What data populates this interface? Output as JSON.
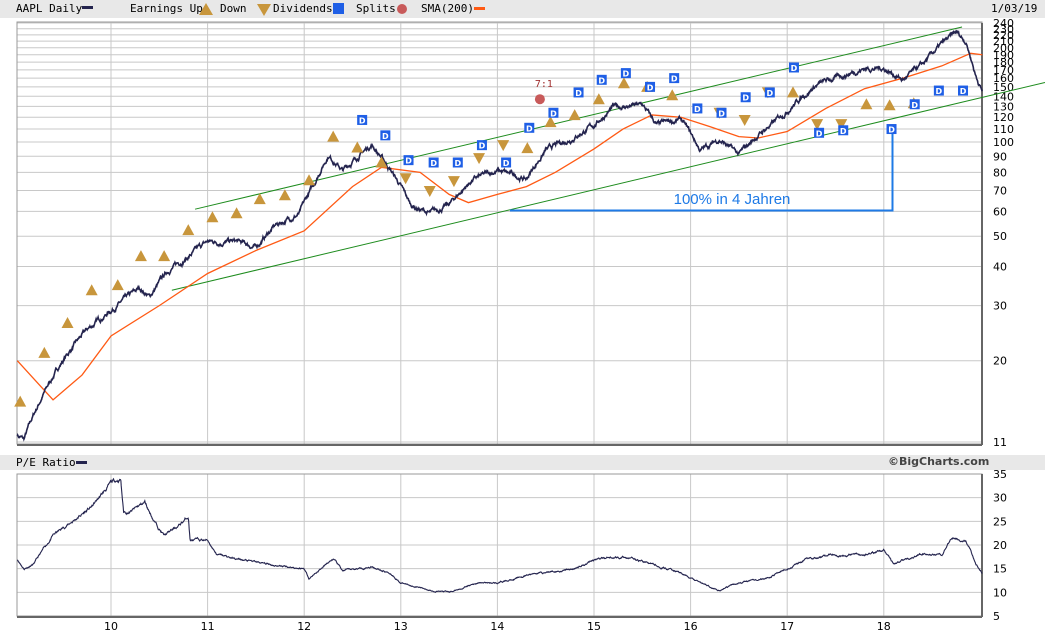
{
  "header": {
    "symbol_label": "AAPL Daily",
    "earnings_up_label": "Earnings Up",
    "down_label": "Down",
    "dividends_label": "Dividends",
    "splits_label": "Splits",
    "sma_label": "SMA(200)",
    "date": "1/03/19"
  },
  "lower_header": {
    "title": "P/E Ratio",
    "copyright": "©BigCharts.com"
  },
  "colors": {
    "price": "#24244e",
    "sma": "#ff5a14",
    "earnings": "#c8963c",
    "dividend": "#1f5fe6",
    "split": "#c85a5a",
    "channel": "#1e8c1e",
    "annotation": "#1e7ae6",
    "grid": "#c8c8c8"
  },
  "chart_data": [
    {
      "type": "line",
      "title": "AAPL Daily",
      "scale": "log",
      "ylim": [
        11,
        240
      ],
      "xlim": [
        2009.03,
        2019.02
      ],
      "y_ticks": [
        "240",
        "230",
        "220",
        "210",
        "200",
        "190",
        "180",
        "170",
        "160",
        "150",
        "140",
        "130",
        "120",
        "110",
        "100",
        "90",
        "80",
        "70",
        "60",
        "50",
        "40",
        "30",
        "20",
        "11"
      ],
      "x_ticks": [
        "10",
        "11",
        "12",
        "13",
        "14",
        "15",
        "16",
        "17",
        "18"
      ],
      "series": [
        {
          "name": "AAPL",
          "points": [
            [
              2009.03,
              11.6
            ],
            [
              2009.1,
              11.2
            ],
            [
              2009.3,
              15.6
            ],
            [
              2009.5,
              20
            ],
            [
              2009.75,
              25
            ],
            [
              2010.0,
              29
            ],
            [
              2010.3,
              34
            ],
            [
              2010.4,
              32
            ],
            [
              2010.6,
              39
            ],
            [
              2010.8,
              43
            ],
            [
              2011.0,
              48
            ],
            [
              2011.3,
              48
            ],
            [
              2011.5,
              46
            ],
            [
              2011.7,
              54
            ],
            [
              2011.95,
              59
            ],
            [
              2012.1,
              73
            ],
            [
              2012.25,
              91
            ],
            [
              2012.4,
              81
            ],
            [
              2012.7,
              98
            ],
            [
              2012.9,
              81
            ],
            [
              2013.1,
              63
            ],
            [
              2013.3,
              59
            ],
            [
              2013.5,
              63
            ],
            [
              2013.75,
              76
            ],
            [
              2014.0,
              81
            ],
            [
              2014.3,
              76
            ],
            [
              2014.5,
              94
            ],
            [
              2014.75,
              102
            ],
            [
              2015.0,
              113
            ],
            [
              2015.2,
              129
            ],
            [
              2015.5,
              131
            ],
            [
              2015.65,
              113
            ],
            [
              2015.9,
              118
            ],
            [
              2016.1,
              94
            ],
            [
              2016.3,
              102
            ],
            [
              2016.5,
              91
            ],
            [
              2016.7,
              105
            ],
            [
              2016.9,
              118
            ],
            [
              2017.1,
              135
            ],
            [
              2017.3,
              152
            ],
            [
              2017.6,
              164
            ],
            [
              2017.8,
              172
            ],
            [
              2018.0,
              172
            ],
            [
              2018.2,
              158
            ],
            [
              2018.4,
              176
            ],
            [
              2018.6,
              205
            ],
            [
              2018.75,
              223
            ],
            [
              2018.85,
              210
            ],
            [
              2018.95,
              164
            ],
            [
              2019.02,
              145
            ]
          ]
        },
        {
          "name": "SMA(200)",
          "points": [
            [
              2009.03,
              20
            ],
            [
              2009.4,
              15
            ],
            [
              2009.7,
              18
            ],
            [
              2010.0,
              24
            ],
            [
              2010.5,
              30
            ],
            [
              2011.0,
              38
            ],
            [
              2011.5,
              45
            ],
            [
              2012.0,
              52
            ],
            [
              2012.5,
              72
            ],
            [
              2012.8,
              83
            ],
            [
              2013.2,
              80
            ],
            [
              2013.5,
              68
            ],
            [
              2013.7,
              64
            ],
            [
              2014.0,
              68
            ],
            [
              2014.3,
              72
            ],
            [
              2014.6,
              80
            ],
            [
              2015.0,
              95
            ],
            [
              2015.3,
              110
            ],
            [
              2015.6,
              122
            ],
            [
              2015.9,
              120
            ],
            [
              2016.2,
              112
            ],
            [
              2016.5,
              104
            ],
            [
              2016.7,
              103
            ],
            [
              2017.0,
              108
            ],
            [
              2017.4,
              128
            ],
            [
              2017.8,
              148
            ],
            [
              2018.2,
              160
            ],
            [
              2018.6,
              175
            ],
            [
              2018.9,
              192
            ],
            [
              2019.02,
              190
            ]
          ]
        }
      ],
      "earnings": [
        [
          2009.06,
          14.8,
          "up"
        ],
        [
          2009.31,
          21.2,
          "up"
        ],
        [
          2009.55,
          26.4,
          "up"
        ],
        [
          2009.8,
          33.6,
          "up"
        ],
        [
          2010.07,
          34.9,
          "up"
        ],
        [
          2010.31,
          43.2,
          "up"
        ],
        [
          2010.55,
          43.2,
          "up"
        ],
        [
          2010.8,
          52.3,
          "up"
        ],
        [
          2011.05,
          57.5,
          "up"
        ],
        [
          2011.3,
          59.2,
          "up"
        ],
        [
          2011.54,
          65.7,
          "up"
        ],
        [
          2011.8,
          67.6,
          "up"
        ],
        [
          2012.05,
          75.5,
          "up"
        ],
        [
          2012.3,
          104,
          "up"
        ],
        [
          2012.55,
          96,
          "up"
        ],
        [
          2012.8,
          86,
          "up"
        ],
        [
          2013.05,
          76.6,
          "down"
        ],
        [
          2013.3,
          69.7,
          "down"
        ],
        [
          2013.55,
          75,
          "down"
        ],
        [
          2013.81,
          88.8,
          "down"
        ],
        [
          2014.06,
          97.7,
          "down"
        ],
        [
          2014.31,
          95.6,
          "up"
        ],
        [
          2014.55,
          115.7,
          "up"
        ],
        [
          2014.8,
          121.8,
          "up"
        ],
        [
          2015.05,
          137,
          "up"
        ],
        [
          2015.31,
          154,
          "up"
        ],
        [
          2015.55,
          150,
          "up"
        ],
        [
          2015.81,
          141,
          "up"
        ],
        [
          2016.3,
          124,
          "down"
        ],
        [
          2016.56,
          117.6,
          "down"
        ],
        [
          2016.8,
          144,
          "down"
        ],
        [
          2017.06,
          144,
          "up"
        ],
        [
          2017.31,
          114,
          "down"
        ],
        [
          2017.56,
          114,
          "down"
        ],
        [
          2017.82,
          132,
          "up"
        ],
        [
          2018.06,
          131,
          "up"
        ],
        [
          2018.31,
          133,
          "up"
        ]
      ],
      "dividends": [
        [
          2012.6,
          117.6
        ],
        [
          2012.84,
          105
        ],
        [
          2013.08,
          87.5
        ],
        [
          2013.34,
          86
        ],
        [
          2013.59,
          86
        ],
        [
          2013.84,
          97.7
        ],
        [
          2014.09,
          86
        ],
        [
          2014.33,
          111
        ],
        [
          2014.58,
          124
        ],
        [
          2014.84,
          144
        ],
        [
          2015.08,
          158
        ],
        [
          2015.33,
          166
        ],
        [
          2015.58,
          150
        ],
        [
          2015.83,
          160
        ],
        [
          2016.07,
          128
        ],
        [
          2016.32,
          124
        ],
        [
          2016.57,
          139
        ],
        [
          2016.82,
          144
        ],
        [
          2017.07,
          173
        ],
        [
          2017.33,
          107
        ],
        [
          2017.58,
          109
        ],
        [
          2018.08,
          110
        ],
        [
          2018.32,
          132
        ],
        [
          2018.57,
          146
        ],
        [
          2018.82,
          146
        ]
      ],
      "splits": [
        {
          "date": 2014.44,
          "price": 137,
          "label": "7:1"
        }
      ],
      "channel_lines": [
        [
          [
            2010.87,
            61
          ],
          [
            2018.81,
            233
          ]
        ],
        [
          [
            2010.63,
            33.6
          ],
          [
            2019.67,
            155
          ]
        ]
      ],
      "annotation": {
        "text": "100% in 4 Jahren",
        "start": [
          2014.13,
          60.4
        ],
        "corner": [
          2018.09,
          60.4
        ],
        "end": [
          2018.09,
          113
        ]
      }
    },
    {
      "type": "line",
      "title": "P/E Ratio",
      "ylim": [
        5,
        35
      ],
      "y_ticks": [
        "35",
        "30",
        "25",
        "20",
        "15",
        "10",
        "5"
      ],
      "x_ticks": [
        "10",
        "11",
        "12",
        "13",
        "14",
        "15",
        "16",
        "17",
        "18"
      ],
      "series": [
        {
          "name": "P/E Ratio",
          "points": [
            [
              2009.03,
              17
            ],
            [
              2009.1,
              15
            ],
            [
              2009.2,
              16
            ],
            [
              2009.4,
              22
            ],
            [
              2009.6,
              25
            ],
            [
              2009.8,
              28
            ],
            [
              2010.0,
              33
            ],
            [
              2010.1,
              34
            ],
            [
              2010.13,
              27
            ],
            [
              2010.2,
              27
            ],
            [
              2010.35,
              29
            ],
            [
              2010.45,
              25
            ],
            [
              2010.55,
              22
            ],
            [
              2010.7,
              24
            ],
            [
              2010.8,
              26
            ],
            [
              2010.82,
              21
            ],
            [
              2011.0,
              21
            ],
            [
              2011.1,
              18
            ],
            [
              2011.3,
              17
            ],
            [
              2011.6,
              16
            ],
            [
              2012.0,
              15
            ],
            [
              2012.05,
              13
            ],
            [
              2012.3,
              17
            ],
            [
              2012.4,
              14.5
            ],
            [
              2012.7,
              15.5
            ],
            [
              2012.9,
              14
            ],
            [
              2013.0,
              12
            ],
            [
              2013.3,
              10.5
            ],
            [
              2013.5,
              10
            ],
            [
              2013.8,
              12
            ],
            [
              2014.0,
              12
            ],
            [
              2014.4,
              14
            ],
            [
              2014.8,
              15
            ],
            [
              2015.0,
              17
            ],
            [
              2015.3,
              17.5
            ],
            [
              2015.6,
              16
            ],
            [
              2015.9,
              14
            ],
            [
              2016.1,
              12
            ],
            [
              2016.3,
              10.5
            ],
            [
              2016.5,
              12
            ],
            [
              2016.8,
              13
            ],
            [
              2017.0,
              15
            ],
            [
              2017.2,
              17
            ],
            [
              2017.5,
              18
            ],
            [
              2017.8,
              18
            ],
            [
              2018.0,
              19
            ],
            [
              2018.1,
              16
            ],
            [
              2018.4,
              18
            ],
            [
              2018.6,
              18
            ],
            [
              2018.7,
              21.5
            ],
            [
              2018.85,
              21
            ],
            [
              2018.95,
              16
            ],
            [
              2019.02,
              14
            ]
          ]
        }
      ]
    }
  ]
}
